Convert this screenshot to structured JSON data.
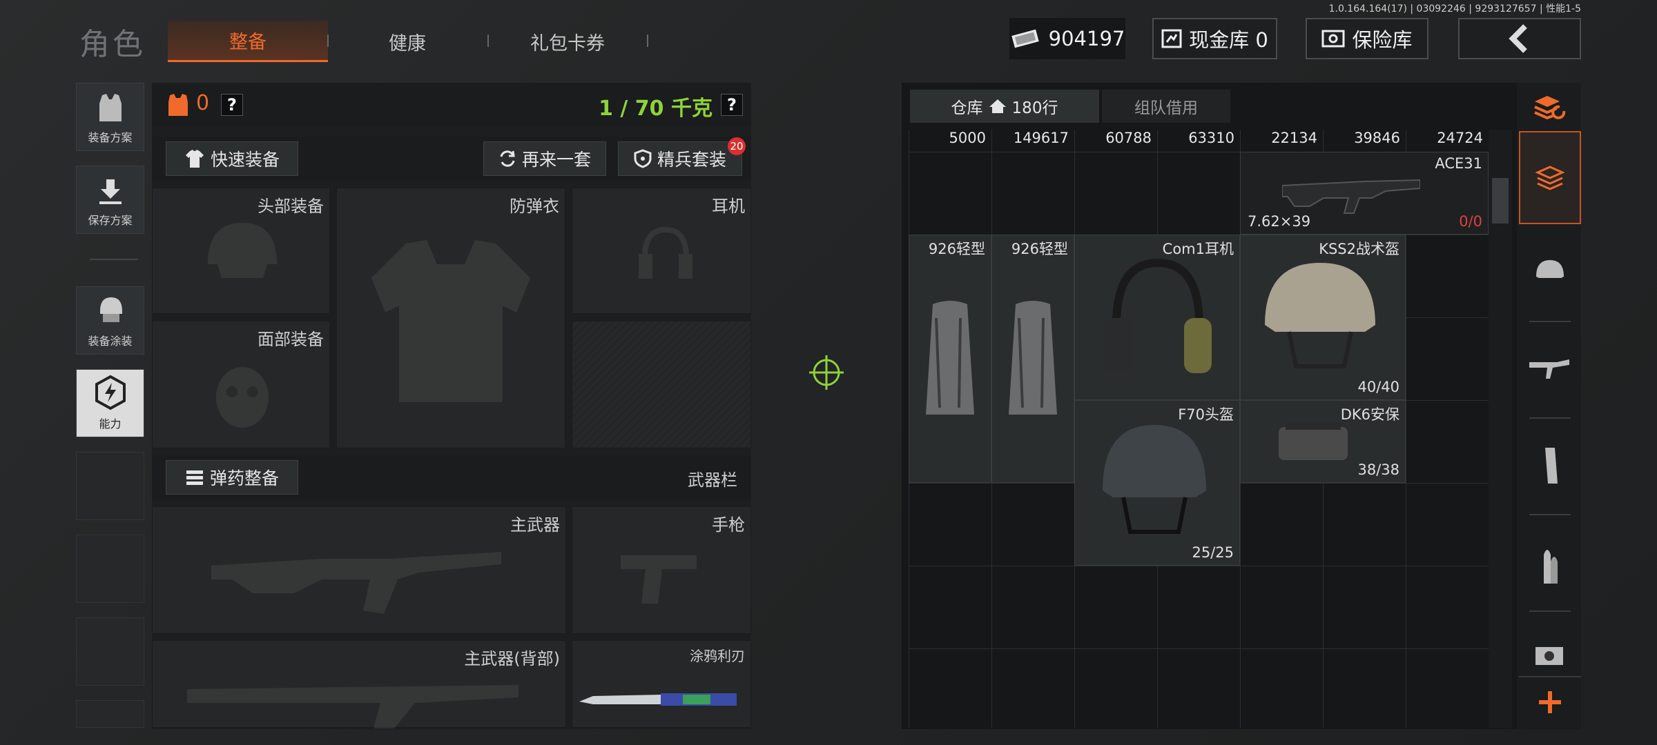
{
  "version": "1.0.164.164(17) | 03092246 | 9293127657 | 性能1-5",
  "header": {
    "title": "角色",
    "tabs": [
      "整备",
      "健康",
      "礼包卡券"
    ],
    "currency": "904197",
    "cash_vault": "现金库 0",
    "safe_box": "保险库"
  },
  "sidebar": {
    "items": [
      "装备方案",
      "保存方案",
      "装备涂装",
      "能力"
    ]
  },
  "loadout": {
    "armor_count": "0",
    "weight": "1 / 70 千克",
    "quick_equip": "快速装备",
    "again": "再来一套",
    "elite": "精兵套装",
    "elite_badge": "20",
    "slots": {
      "head": "头部装备",
      "armor": "防弹衣",
      "headset": "耳机",
      "face": "面部装备",
      "ammo": "弹药整备",
      "weapon_bar": "武器栏",
      "primary": "主武器",
      "pistol": "手枪",
      "primary_back": "主武器(背部)",
      "knife": "涂鸦利刃"
    }
  },
  "warehouse": {
    "tab_warehouse": "仓库",
    "rows": "180行",
    "tab_team": "组队借用",
    "top_numbers": [
      "5000",
      "149617",
      "60788",
      "63310",
      "22134",
      "39846",
      "24724"
    ],
    "items": [
      {
        "name": "ACE31",
        "caliber": "7.62×39",
        "ammo": "0/0"
      },
      {
        "name": "926轻型"
      },
      {
        "name": "926轻型"
      },
      {
        "name": "Com1耳机"
      },
      {
        "name": "KSS2战术盔",
        "durability": "40/40"
      },
      {
        "name": "F70头盔",
        "durability": "25/25"
      },
      {
        "name": "DK6安保",
        "durability": "38/38"
      }
    ]
  },
  "colors": {
    "accent": "#f06a2c",
    "weight": "#8fd33a",
    "ammo_empty": "#e04040"
  }
}
